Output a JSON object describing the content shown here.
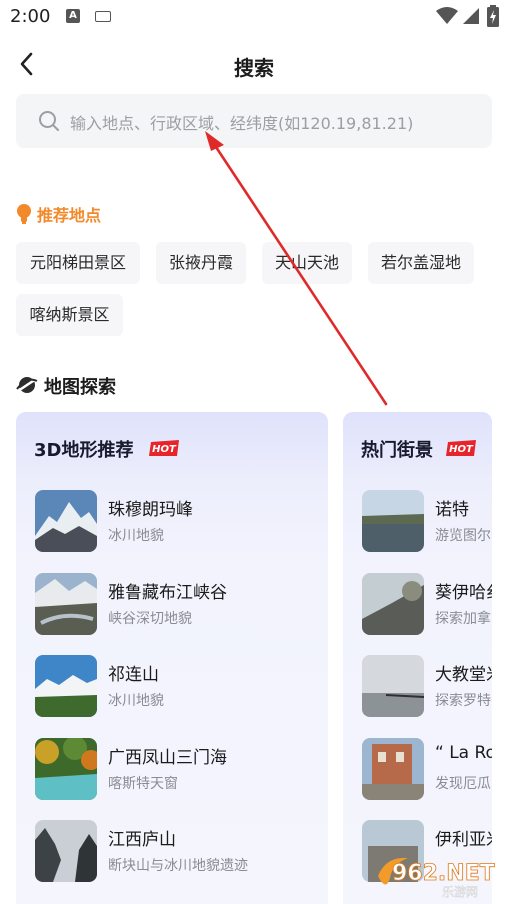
{
  "status_bar": {
    "time": "2:00",
    "a_badge": "A"
  },
  "header": {
    "title": "搜索"
  },
  "search": {
    "placeholder": "输入地点、行政区域、经纬度(如120.19,81.21)"
  },
  "recommended": {
    "title": "推荐地点",
    "chips": [
      "元阳梯田景区",
      "张掖丹霞",
      "天山天池",
      "若尔盖湿地",
      "喀纳斯景区"
    ]
  },
  "explore": {
    "title": "地图探索",
    "terrain": {
      "title": "3D地形推荐",
      "hot": "HOT",
      "items": [
        {
          "name": "珠穆朗玛峰",
          "desc": "冰川地貌"
        },
        {
          "name": "雅鲁藏布江峡谷",
          "desc": "峡谷深切地貌"
        },
        {
          "name": "祁连山",
          "desc": "冰川地貌"
        },
        {
          "name": "广西凤山三门海",
          "desc": "喀斯特天窗"
        },
        {
          "name": "江西庐山",
          "desc": "断块山与冰川地貌遗迹"
        }
      ]
    },
    "street": {
      "title": "热门街景",
      "hot": "HOT",
      "items": [
        {
          "name": "诺特",
          "desc": "游览图尔"
        },
        {
          "name": "葵伊哈纟",
          "desc": "探索加拿"
        },
        {
          "name": "大教堂米",
          "desc": "探索罗特"
        },
        {
          "name": "“ La Ro",
          "desc": "发现厄瓜"
        },
        {
          "name": "伊利亚米",
          "desc": ""
        }
      ]
    }
  },
  "watermark": {
    "text": "962.NET",
    "sub": "乐游网"
  }
}
